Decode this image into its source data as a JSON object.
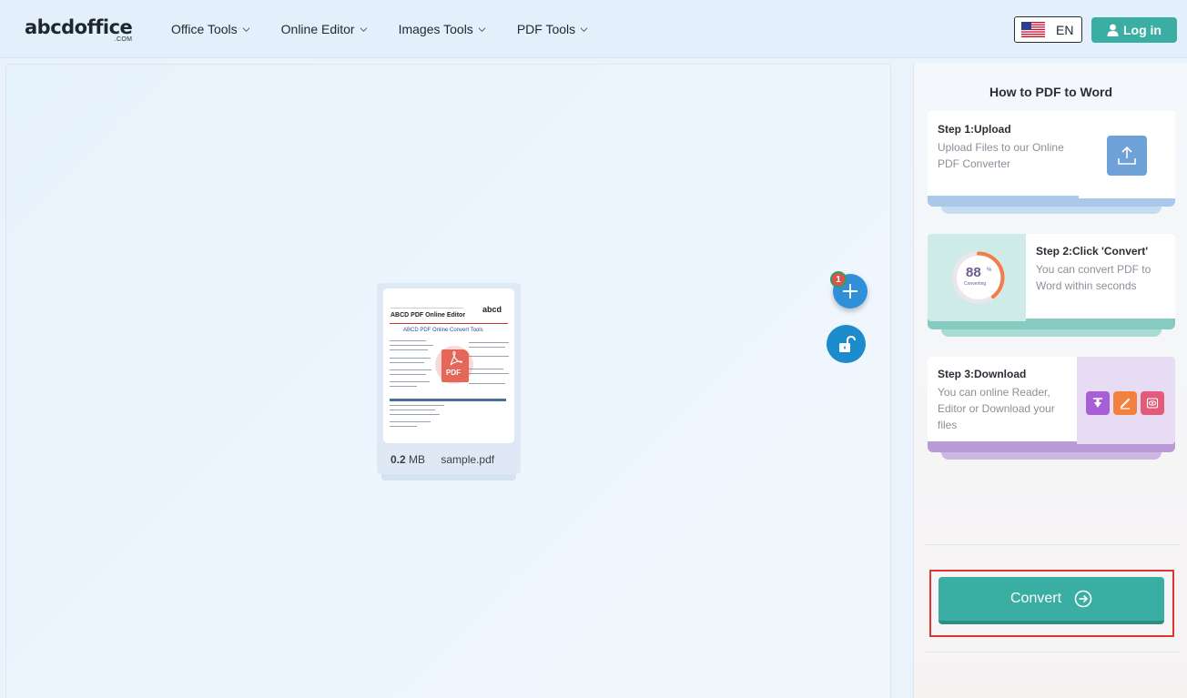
{
  "header": {
    "logo_text": "abcdoffice",
    "logo_sub": ".COM",
    "nav": [
      {
        "label": "Office Tools"
      },
      {
        "label": "Online Editor"
      },
      {
        "label": "Images Tools"
      },
      {
        "label": "PDF Tools"
      }
    ],
    "language": "EN",
    "login_label": "Log in"
  },
  "workspace": {
    "file": {
      "size_value": "0.2",
      "size_unit": "MB",
      "name": "sample.pdf",
      "thumb_title": "ABCD PDF Online Editor",
      "thumb_subtitle": "ABCD PDF Online Convert Tools",
      "thumb_logo": "abcd",
      "badge_text": "PDF"
    },
    "file_count": "1"
  },
  "side": {
    "title": "How to PDF to Word",
    "steps": [
      {
        "title": "Step 1:Upload",
        "desc": "Upload Files to our Online PDF Converter"
      },
      {
        "title": "Step 2:Click 'Convert'",
        "desc": "You can convert PDF to Word within seconds",
        "progress_value": "88",
        "progress_unit": "%",
        "progress_label": "Converting",
        "progress_fraction": 0.88
      },
      {
        "title": "Step 3:Download",
        "desc": "You can online Reader, Editor or Download your files"
      }
    ],
    "convert_label": "Convert"
  },
  "colors": {
    "accent": "#3aaea3",
    "highlight_frame": "#e03535",
    "primary_blue": "#2f8fd8"
  },
  "icons": {
    "nav_chevron": "chevron-down-icon",
    "login": "user-icon",
    "add": "plus-icon",
    "lock": "unlock-icon",
    "upload": "upload-icon",
    "download": "download-icon",
    "edit": "pencil-icon",
    "view": "eye-icon",
    "convert": "arrow-right-circle-icon"
  }
}
